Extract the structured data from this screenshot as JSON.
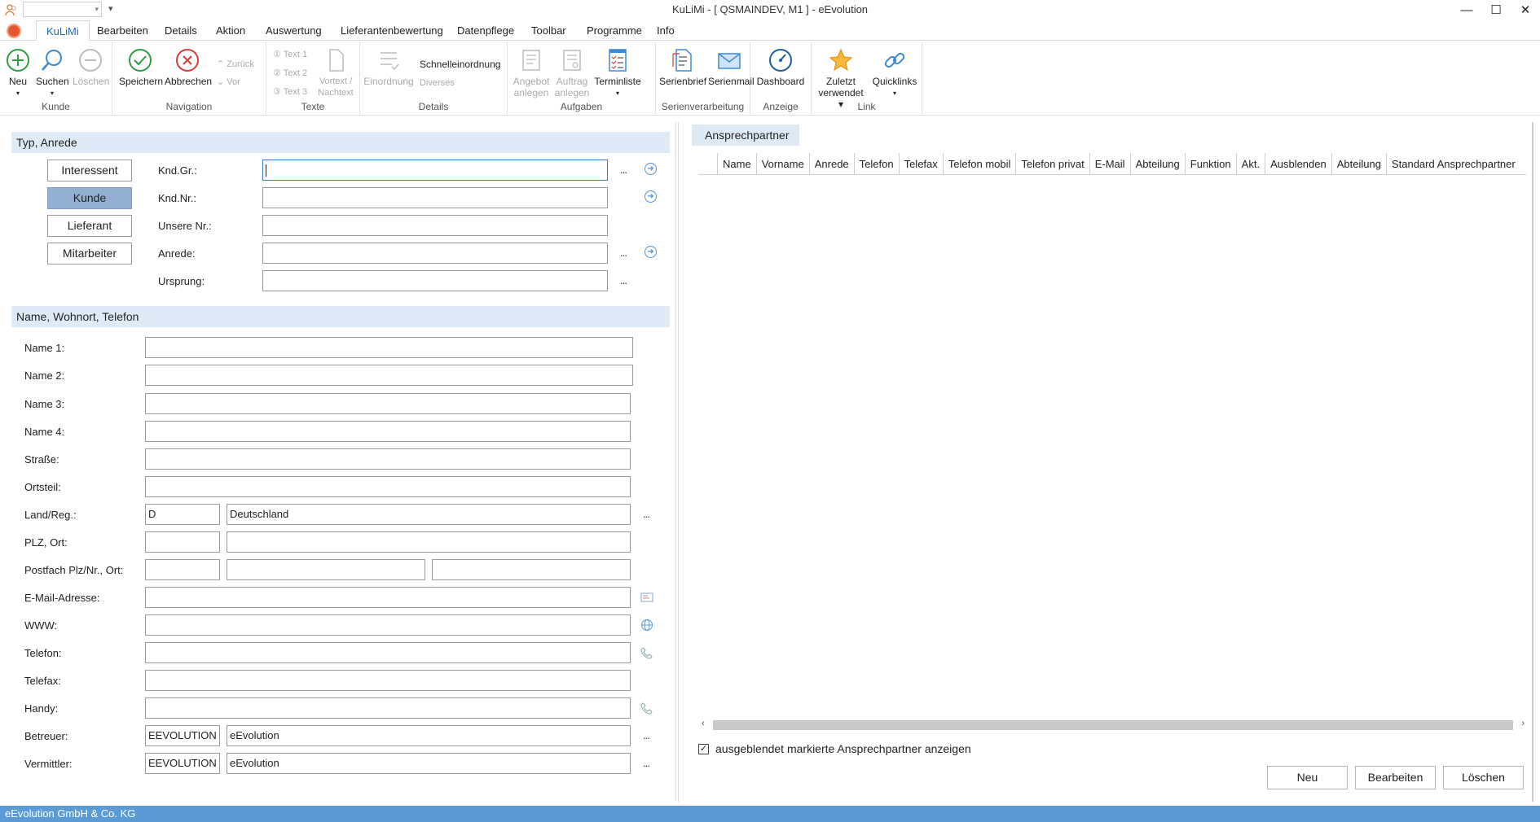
{
  "window": {
    "title": "KuLiMi - [ QSMAINDEV, M1 ]  -  eEvolution"
  },
  "ribbon_tabs": [
    "KuLiMi",
    "Bearbeiten",
    "Details",
    "Aktion",
    "Auswertung",
    "Lieferantenbewertung",
    "Datenpflege",
    "Toolbar",
    "Programme",
    "Info"
  ],
  "ribbon": {
    "kunde": {
      "label": "Kunde",
      "neu": "Neu",
      "suchen": "Suchen",
      "loeschen": "Löschen"
    },
    "navigation": {
      "label": "Navigation",
      "speichern": "Speichern",
      "abbrechen": "Abbrechen",
      "zurueck": "Zurück",
      "vor": "Vor"
    },
    "texte": {
      "label": "Texte",
      "text1": "Text 1",
      "text2": "Text 2",
      "text3": "Text 3",
      "vortext": "Vortext /",
      "nachtext": "Nachtext"
    },
    "details": {
      "label": "Details",
      "einordnung": "Einordnung",
      "schnelleinordnung": "Schnelleinordnung",
      "diverses": "Diverses"
    },
    "aufgaben": {
      "label": "Aufgaben",
      "angebot1": "Angebot",
      "angebot2": "anlegen",
      "auftrag1": "Auftrag",
      "auftrag2": "anlegen",
      "terminliste": "Terminliste"
    },
    "serien": {
      "label": "Serienverarbeitung",
      "serienbrief": "Serienbrief",
      "serienmail": "Serienmail"
    },
    "anzeige": {
      "label": "Anzeige",
      "dashboard": "Dashboard"
    },
    "link": {
      "label": "Link",
      "zuletzt1": "Zuletzt",
      "zuletzt2": "verwendet",
      "quicklinks": "Quicklinks"
    }
  },
  "section_typ": {
    "title": "Typ, Anrede",
    "buttons": [
      "Interessent",
      "Kunde",
      "Lieferant",
      "Mitarbeiter"
    ],
    "selected": "Kunde",
    "labels": {
      "kndgr": "Knd.Gr.:",
      "kndnr": "Knd.Nr.:",
      "unsere_nr": "Unsere Nr.:",
      "anrede": "Anrede:",
      "ursprung": "Ursprung:"
    },
    "values": {
      "kndgr": "",
      "kndnr": "",
      "unsere_nr": "",
      "anrede": "",
      "ursprung": ""
    },
    "dots": "..."
  },
  "section_name": {
    "title": "Name, Wohnort, Telefon",
    "labels": {
      "name1": "Name 1:",
      "name2": "Name 2:",
      "name3": "Name 3:",
      "name4": "Name 4:",
      "strasse": "Straße:",
      "ortsteil": "Ortsteil:",
      "land": "Land/Reg.:",
      "plz": "PLZ, Ort:",
      "postfach": "Postfach Plz/Nr., Ort:",
      "email": "E-Mail-Adresse:",
      "www": "WWW:",
      "telefon": "Telefon:",
      "telefax": "Telefax:",
      "handy": "Handy:",
      "betreuer": "Betreuer:",
      "vermittler": "Vermittler:"
    },
    "values": {
      "land_code": "D",
      "land_name": "Deutschland",
      "betreuer_code": "EEVOLUTION",
      "betreuer_name": "eEvolution",
      "vermittler_code": "EEVOLUTION",
      "vermittler_name": "eEvolution"
    }
  },
  "contacts": {
    "tab_title": "Ansprechpartner",
    "columns": [
      "Name",
      "Vorname",
      "Anrede",
      "Telefon",
      "Telefax",
      "Telefon mobil",
      "Telefon privat",
      "E-Mail",
      "Abteilung",
      "Funktion",
      "Akt.",
      "Ausblenden",
      "Abteilung",
      "Standard Ansprechpartner"
    ],
    "rows": [],
    "show_hidden_label": "ausgeblendet markierte Ansprechpartner anzeigen",
    "show_hidden_checked": true,
    "buttons": {
      "neu": "Neu",
      "bearbeiten": "Bearbeiten",
      "loeschen": "Löschen"
    }
  },
  "statusbar": {
    "text": "eEvolution GmbH & Co. KG"
  },
  "colors": {
    "section_bg": "#deebf7",
    "selected_type": "#93afd1",
    "status": "#5b9bd5",
    "accent": "#2b6cb0"
  }
}
